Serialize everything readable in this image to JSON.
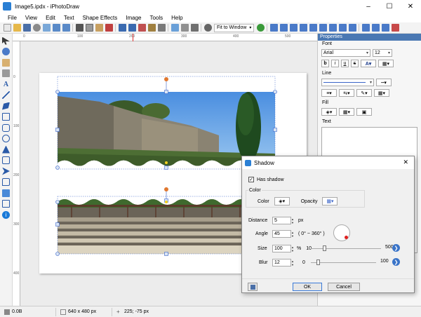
{
  "window": {
    "title": "Image5.ipdx - iPhotoDraw",
    "minimize": "–",
    "maximize": "☐",
    "close": "✕"
  },
  "menu": [
    "File",
    "View",
    "Edit",
    "Text",
    "Shape Effects",
    "Image",
    "Tools",
    "Help"
  ],
  "toolbar": {
    "zoom_label": "Fit to Window"
  },
  "rulers": {
    "h_labels": [
      "0",
      "100",
      "200",
      "300",
      "400",
      "500"
    ],
    "v_labels": [
      "0",
      "100",
      "200",
      "300",
      "400"
    ]
  },
  "properties": {
    "header": "Properties",
    "font_section": "Font",
    "font_family": "Arial",
    "font_size": "12",
    "bold": "b",
    "italic": "i",
    "underline": "u",
    "strike": "s",
    "line_section": "Line",
    "fill_section": "Fill",
    "text_section": "Text"
  },
  "status": {
    "size_value": "0.0B",
    "dimensions": "640 x 480 px",
    "cursor": "225; -75 px"
  },
  "shadow_dialog": {
    "title": "Shadow",
    "close_glyph": "✕",
    "has_shadow_label": "Has shadow",
    "has_shadow_checked": true,
    "color_group": "Color",
    "color_label": "Color",
    "opacity_label": "Opacity",
    "distance_label": "Distance",
    "distance_value": "5",
    "distance_unit": "px",
    "angle_label": "Angle",
    "angle_value": "45",
    "angle_range": "( 0° ~ 360° )",
    "size_label": "Size",
    "size_value": "100",
    "size_unit": "%",
    "size_min": "10",
    "size_max": "500",
    "size_level": 0.2,
    "blur_label": "Blur",
    "blur_value": "12",
    "blur_min": "0",
    "blur_max": "100",
    "blur_level": 0.12,
    "ok_label": "OK",
    "cancel_label": "Cancel"
  },
  "colors": {
    "accent": "#4a78b3",
    "selection": "#3a64c8",
    "handle_rotate": "#e07830"
  }
}
